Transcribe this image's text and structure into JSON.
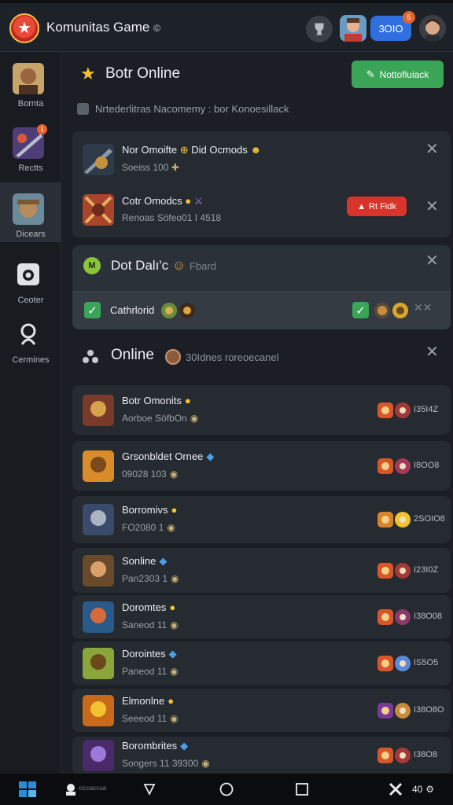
{
  "app": {
    "title": "Komunitas Game",
    "title_suffix": "©",
    "coin_value": "3OIO",
    "coin_badge": "5"
  },
  "sidebar": {
    "items": [
      {
        "label": "Bornta",
        "badge": ""
      },
      {
        "label": "Rectts",
        "badge": "1"
      },
      {
        "label": "Dicears",
        "badge": ""
      },
      {
        "label": "Ceoter",
        "badge": ""
      },
      {
        "label": "Cermines",
        "badge": ""
      }
    ]
  },
  "section_online": {
    "title": "Botr Online",
    "button_label": "Nottofluiack",
    "notice": "Nrtederlitras Nacomemy : bor Konoesillack"
  },
  "requests": [
    {
      "title": "Nor Omoifte",
      "title_extra": "Did Ocmods",
      "sub": "Soeiss 100"
    },
    {
      "title": "Cotr Omodcs",
      "title_extra": "",
      "sub": "Renoas Söfeo01 I 4518",
      "action_label": "Rt Fidk"
    }
  ],
  "achievement": {
    "title": "Dot Dalı'c",
    "title_extra": "Fbard",
    "item_label": "Cathrlorid"
  },
  "section_friends": {
    "title": "Online",
    "subtitle": "30Idnes roreoecanel"
  },
  "friends": [
    {
      "name": "Botr Omonits",
      "status": "Aorboe SöfbOn",
      "stat": "I35I4Z"
    },
    {
      "name": "Grsonbldet Ornee",
      "status": "09028 103",
      "stat": "I8OO8"
    },
    {
      "name": "Borromivs",
      "status": "FO2080 1",
      "stat": "2SOIO8"
    },
    {
      "name": "Sonline",
      "status": "Pan2303 1",
      "stat": "I23I0Z"
    },
    {
      "name": "Doromtes",
      "status": "Saneod 11",
      "stat": "I38O08"
    },
    {
      "name": "Dorointes",
      "status": "Paneod 11",
      "stat": "IS5O5"
    },
    {
      "name": "Elmonlne",
      "status": "Seeeod 11",
      "stat": "I38O8O"
    },
    {
      "name": "Borombrites",
      "status": "Songers 11 39300",
      "stat": "I38O8"
    }
  ],
  "nav": {
    "label": "ciccaccua",
    "right_label": "40"
  },
  "colors": {
    "accent_green": "#3aa557",
    "accent_blue": "#2f6fe0",
    "accent_red": "#d9342b",
    "badge_orange": "#e8632a"
  }
}
